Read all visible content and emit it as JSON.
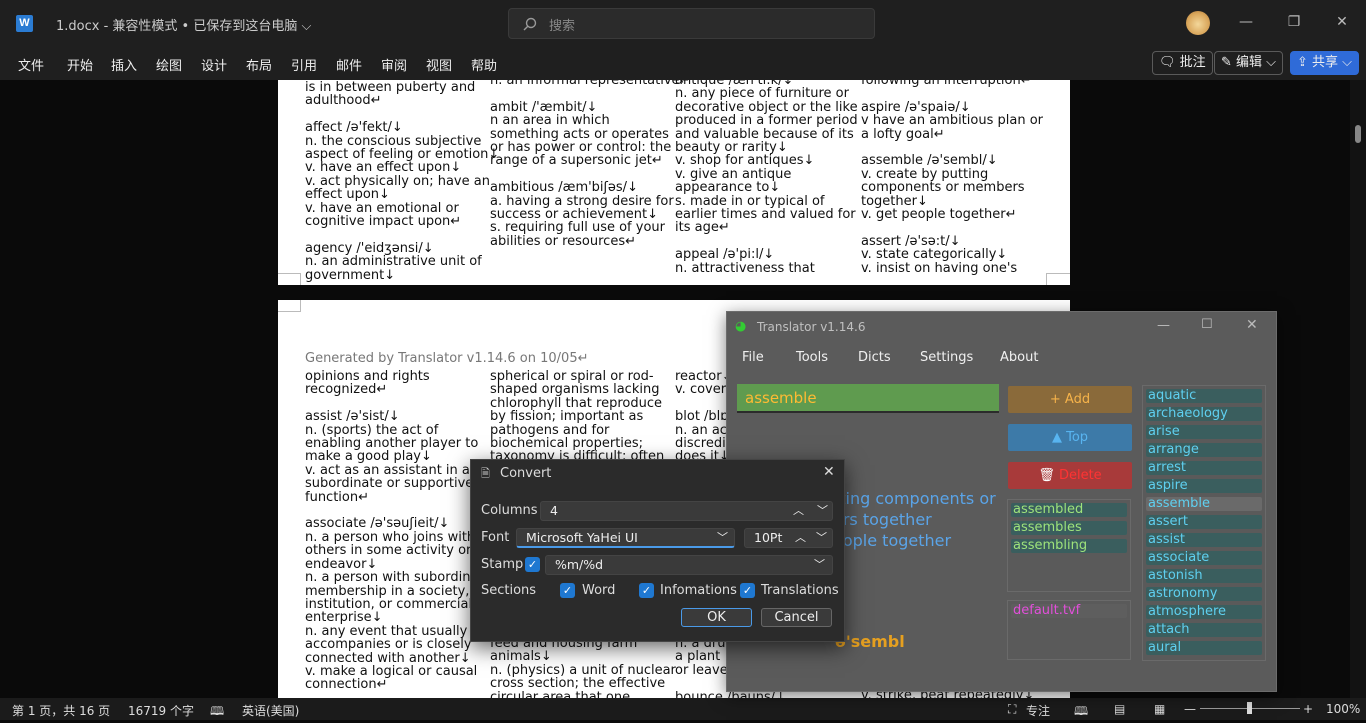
{
  "window": {
    "doc_title": "1.docx  -  兼容性模式 • 已保存到这台电脑 ⌵",
    "search_placeholder": "搜索",
    "min": "—",
    "max": "❐",
    "close": "✕"
  },
  "ribbon": {
    "tabs": [
      "文件",
      "开始",
      "插入",
      "绘图",
      "设计",
      "布局",
      "引用",
      "邮件",
      "审阅",
      "视图",
      "帮助"
    ],
    "comment": "批注",
    "edit": "编辑 ⌵",
    "share": "共享 ⌵"
  },
  "page1": {
    "col1": "is in between puberty and\nadulthood↵\n\naffect /ə'fekt/↓\nn. the conscious subjective\naspect of feeling or emotion↓\nv. have an effect upon↓\nv. act physically on; have an\neffect upon↓\nv. have an emotional or\ncognitive impact upon↵\n\nagency /'eidʒənsi/↓\nn. an administrative unit of\ngovernment↓",
    "col2": "n. an informal representative↵\n\nambit /'æmbit/↓\nn an area in which\nsomething acts or operates\nor has power or control: the\nrange of a supersonic jet↵\n\nambitious /æm'biʃəs/↓\na. having a strong desire for\nsuccess or achievement↓\ns. requiring full use of your\nabilities or resources↵",
    "col3": "antique /æn'ti:k/↓\nn. any piece of furniture or\ndecorative object or the like\nproduced in a former period\nand valuable because of its\nbeauty or rarity↓\nv. shop for antiques↓\nv. give an antique\nappearance to↓\ns. made in or typical of\nearlier times and valued for\nits age↵\n\nappeal /ə'pi:l/↓\nn. attractiveness that",
    "col4": "following an interruption↵\n\naspire /ə'spaiə/↓\nv have an ambitious plan or\na lofty goal↵\n\nassemble /ə'sembl/↓\nv. create by putting\ncomponents or members\ntogether↓\nv. get people together↵\n\nassert /ə'sə:t/↓\nv. state categorically↓\nv. insist on having one's"
  },
  "page2": {
    "header": "Generated by Translator v1.14.6 on 10/05↵",
    "col1": "opinions and rights\nrecognized↵\n\nassist /ə'sist/↓\nn. (sports) the act of\nenabling another player to\nmake a good play↓\nv. act as an assistant in a\nsubordinate or supportive\nfunction↵\n\nassociate /ə'səuʃieit/↓\nn. a person who joins with\nothers in some activity or\nendeavor↓\nn. a person with subordina\nmembership in a society,\ninstitution, or commercial\nenterprise↓\nn. any event that usually\naccompanies or is closely\nconnected with another↓\nv. make a logical or causal\nconnection↵\n\nastonish /ə'stɔniʃ/↓",
    "col2": "spherical or spiral or rod-\nshaped organisms lacking\nchlorophyll that reproduce\nby fission; important as\npathogens and for\nbiochemical properties;\ntaxonomy is difficult; often",
    "col2b": "feed and housing farm\nanimals↓\nn. (physics) a unit of nuclear\ncross section; the effective\ncircular area that one",
    "col3": "reactor↓\nv. cover\n\nblot /blɒ\nn. an act\ndiscredi\ndoes it↓",
    "col3b": "n. a dru\na plant \nor leave\n\nbounce /bauns/↓",
    "col4b": "v. strike, beat repeatedly↓"
  },
  "status": {
    "page": "第 1 页，共 16 页",
    "words": "16719 个字",
    "lang": "英语(美国)",
    "focus": "专注",
    "zoom": "100%"
  },
  "translator": {
    "title": "Translator v1.14.6",
    "menu": [
      "File",
      "Tools",
      "Dicts",
      "Settings",
      "About"
    ],
    "input": "assemble",
    "add": "+ Add",
    "top": "▲ Top",
    "delete": "Delete",
    "definition": "tting components or\ners together\neople together",
    "phonetic": "ə'sembl",
    "forms": [
      "assembled",
      "assembles",
      "assembling"
    ],
    "dict_file": "default.tvf",
    "words": [
      "aquatic",
      "archaeology",
      "arise",
      "arrange",
      "arrest",
      "aspire",
      "assemble",
      "assert",
      "assist",
      "associate",
      "astonish",
      "astronomy",
      "atmosphere",
      "attach",
      "aural"
    ],
    "selected_word": "assemble"
  },
  "convert": {
    "title": "Convert",
    "columns_label": "Columns",
    "columns_value": "4",
    "font_label": "Font",
    "font_value": "Microsoft YaHei UI",
    "size_value": "10Pt",
    "stamp_label": "Stamp",
    "stamp_value": "%m/%d",
    "stamp_checked": true,
    "sections_label": "Sections",
    "sections": [
      {
        "label": "Word",
        "checked": true
      },
      {
        "label": "Infomations",
        "checked": true
      },
      {
        "label": "Translations",
        "checked": true
      }
    ],
    "ok": "OK",
    "cancel": "Cancel"
  }
}
